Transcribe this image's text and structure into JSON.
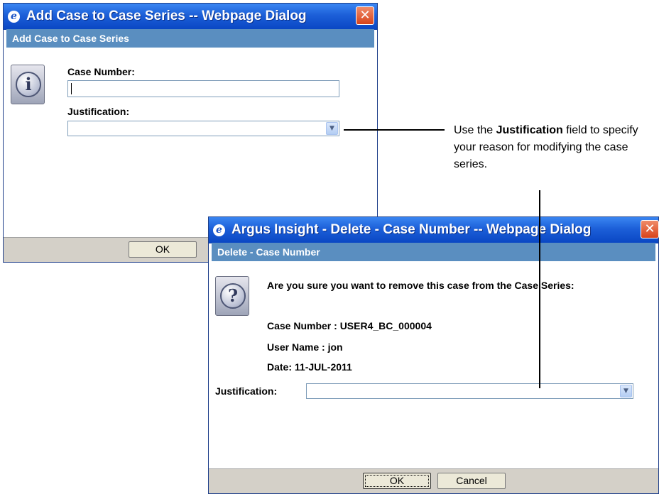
{
  "dialog1": {
    "window_title": "Add Case to Case Series -- Webpage Dialog",
    "close_glyph": "✕",
    "section_title": "Add Case to Case Series",
    "icon": "info-icon",
    "icon_glyph": "i",
    "case_number_label": "Case Number:",
    "case_number_value": "",
    "justification_label": "Justification:",
    "justification_value": "",
    "ok_label": "OK"
  },
  "dialog2": {
    "window_title": "Argus Insight - Delete - Case Number -- Webpage Dialog",
    "close_glyph": "✕",
    "section_title": "Delete - Case Number",
    "icon": "question-icon",
    "icon_glyph": "?",
    "question": "Are you sure you want to remove this case from the Case Series:",
    "case_number_line": "Case Number : USER4_BC_000004",
    "user_name_line": "User Name : jon",
    "date_line": "Date: 11-JUL-2011",
    "justification_label": "Justification:",
    "justification_value": "",
    "ok_label": "OK",
    "cancel_label": "Cancel"
  },
  "callout": {
    "prefix": "Use the ",
    "emphasis": "Justification",
    "suffix": " field to specify your reason for modifying the case series."
  },
  "dropdown_arrow_glyph": "▼",
  "ie_glyph": "e",
  "colors": {
    "titlebar": "#1c5fd8",
    "section_header": "#5a8ec0",
    "footer": "#d4d0c8",
    "close_button": "#d7431b"
  }
}
